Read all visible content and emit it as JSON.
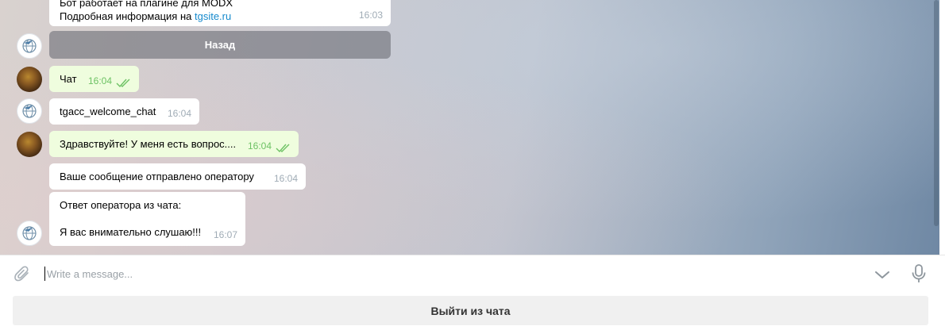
{
  "messages": {
    "m0": {
      "line1": "Бот работает на плагине для MODX",
      "line2_prefix": "Подробная информация на ",
      "link": "tgsite.ru",
      "time": "16:03"
    },
    "keyboard_button": "Назад",
    "m1": {
      "text": "Чат",
      "time": "16:04"
    },
    "m2": {
      "text": "tgacc_welcome_chat",
      "time": "16:04"
    },
    "m3": {
      "text": "Здравствуйте! У меня есть вопрос....",
      "time": "16:04"
    },
    "m4": {
      "text": "Ваше сообщение отправлено оператору",
      "time": "16:04"
    },
    "m5": {
      "line1": "Ответ оператора из чата:",
      "line2": "Я вас внимательно слушаю!!!",
      "time": "16:07"
    }
  },
  "composer": {
    "placeholder": "Write a message..."
  },
  "leave_button": "Выйти из чата",
  "colors": {
    "incoming_bubble": "#ffffff",
    "outgoing_bubble": "#effdde",
    "link": "#168acd",
    "read_checks": "#6dc264"
  },
  "icons": [
    "paperclip-icon",
    "chevron-down-icon",
    "microphone-icon",
    "double-check-icon"
  ]
}
